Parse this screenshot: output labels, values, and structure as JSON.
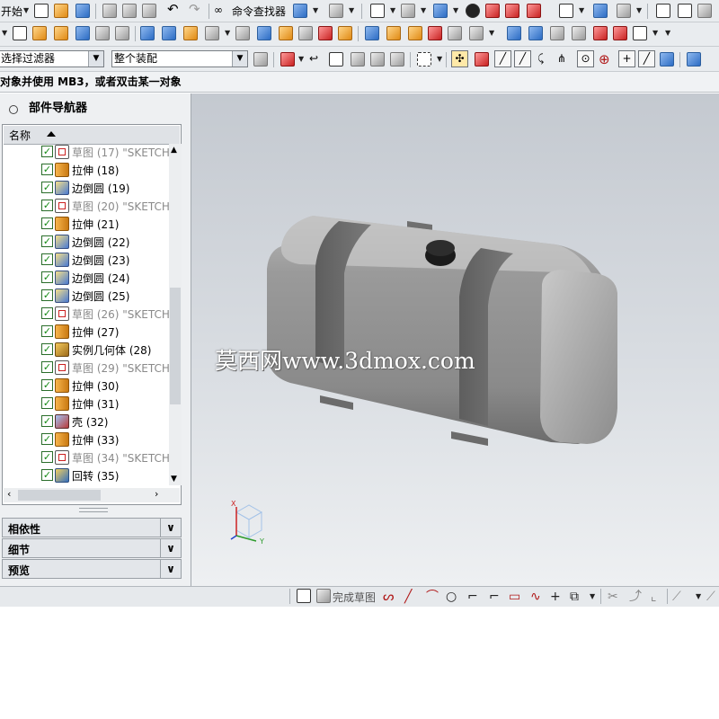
{
  "toolbar1": {
    "start_label": "开始",
    "command_finder_label": "命令查找器"
  },
  "toolbar3": {
    "selection_filter": "选择过滤器",
    "assembly_scope": "整个装配"
  },
  "hint_text": "对象并使用 MB3，或者双击某一对象",
  "navigator": {
    "title": "部件导航器",
    "column_name": "名称",
    "items": [
      {
        "label": "草图 (17) \"SKETCH_",
        "type": "sketch",
        "dim": true
      },
      {
        "label": "拉伸 (18)",
        "type": "extrude",
        "dim": false
      },
      {
        "label": "边倒圆 (19)",
        "type": "blend",
        "dim": false
      },
      {
        "label": "草图 (20) \"SKETCH_",
        "type": "sketch",
        "dim": true
      },
      {
        "label": "拉伸 (21)",
        "type": "extrude",
        "dim": false
      },
      {
        "label": "边倒圆 (22)",
        "type": "blend",
        "dim": false
      },
      {
        "label": "边倒圆 (23)",
        "type": "blend",
        "dim": false
      },
      {
        "label": "边倒圆 (24)",
        "type": "blend",
        "dim": false
      },
      {
        "label": "边倒圆 (25)",
        "type": "blend",
        "dim": false
      },
      {
        "label": "草图 (26) \"SKETCH_",
        "type": "sketch",
        "dim": true
      },
      {
        "label": "拉伸 (27)",
        "type": "extrude",
        "dim": false
      },
      {
        "label": "实例几何体 (28)",
        "type": "pattern",
        "dim": false
      },
      {
        "label": "草图 (29) \"SKETCH_",
        "type": "sketch",
        "dim": true
      },
      {
        "label": "拉伸 (30)",
        "type": "extrude",
        "dim": false
      },
      {
        "label": "拉伸 (31)",
        "type": "extrude",
        "dim": false
      },
      {
        "label": "壳 (32)",
        "type": "shell",
        "dim": false
      },
      {
        "label": "拉伸 (33)",
        "type": "extrude",
        "dim": false
      },
      {
        "label": "草图 (34) \"SKETCH_",
        "type": "sketch",
        "dim": true
      },
      {
        "label": "回转 (35)",
        "type": "revolve",
        "dim": false
      }
    ],
    "check_mark": "✓",
    "sections": [
      {
        "label": "相依性"
      },
      {
        "label": "细节"
      },
      {
        "label": "预览"
      }
    ]
  },
  "viewport": {
    "watermark": "莫西网www.3dmox.com",
    "triad": {
      "x": "X",
      "y": "Y"
    },
    "model": "fuel-tank"
  },
  "sketch_bar": {
    "finish_sketch_label": "完成草图"
  },
  "colors": {
    "toolbar_bg": "#e9ecef",
    "check_green": "#138a13",
    "dim_text": "#8a8a8a"
  }
}
